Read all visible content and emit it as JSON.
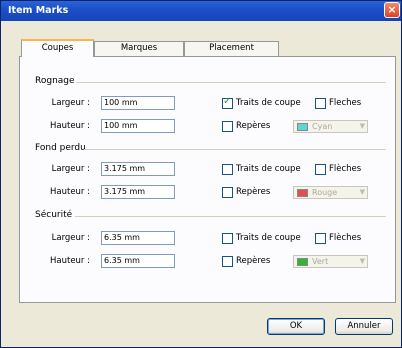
{
  "window": {
    "title": "Item Marks",
    "close_glyph": "×"
  },
  "tabs": [
    "Coupes",
    "Marques",
    "Placement"
  ],
  "sections": [
    {
      "title": "Rognage",
      "largeur_label": "Largeur :",
      "largeur_value": "100 mm",
      "hauteur_label": "Hauteur :",
      "hauteur_value": "100 mm",
      "traits_label": "Traits de coupe",
      "traits_checked": true,
      "fleches_label": "Fleches",
      "reperes_label": "Repères",
      "color_name": "Cyan",
      "color_hex": "#5fd3d8"
    },
    {
      "title": "Fond perdu",
      "largeur_label": "Largeur :",
      "largeur_value": "3.175 mm",
      "hauteur_label": "Hauteur :",
      "hauteur_value": "3.175 mm",
      "traits_label": "Traits de coupe",
      "traits_checked": false,
      "fleches_label": "Flèches",
      "reperes_label": "Repères",
      "color_name": "Rouge",
      "color_hex": "#e05050"
    },
    {
      "title": "Sécurité",
      "largeur_label": "Largeur :",
      "largeur_value": "6.35 mm",
      "hauteur_label": "Hauteur :",
      "hauteur_value": "6.35 mm",
      "traits_label": "Traits de coupe",
      "traits_checked": false,
      "fleches_label": "Flèches",
      "reperes_label": "Repères",
      "color_name": "Vert",
      "color_hex": "#2fb52f"
    }
  ],
  "buttons": {
    "ok": "OK",
    "cancel": "Annuler"
  },
  "colors": {
    "titlebar": "#1c4fc9",
    "dialog": "#ece9d8",
    "tab_accent": "#f6b64b"
  }
}
